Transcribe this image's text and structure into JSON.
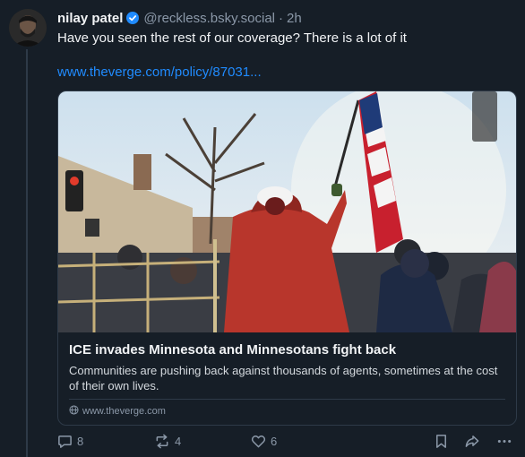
{
  "post": {
    "author": {
      "display_name": "nilay patel",
      "handle": "@reckless.bsky.social",
      "separator": "·",
      "time": "2h",
      "verified": true
    },
    "text": "Have you seen the rest of our coverage? There is a lot of it",
    "link": "www.theverge.com/policy/87031..."
  },
  "card": {
    "title": "ICE invades Minnesota and Minnesotans fight back",
    "description": "Communities are pushing back against thousands of agents, sometimes at the cost of their own lives.",
    "domain": "www.theverge.com"
  },
  "actions": {
    "replies": "8",
    "reposts": "4",
    "likes": "6"
  },
  "colors": {
    "background": "#161e27",
    "link": "#208bfe",
    "verified": "#208bfe",
    "muted": "#8b98a8"
  },
  "icons": [
    "avatar",
    "verified-badge-icon",
    "globe-icon",
    "reply-icon",
    "repost-icon",
    "like-icon",
    "bookmark-icon",
    "share-icon",
    "more-icon"
  ]
}
